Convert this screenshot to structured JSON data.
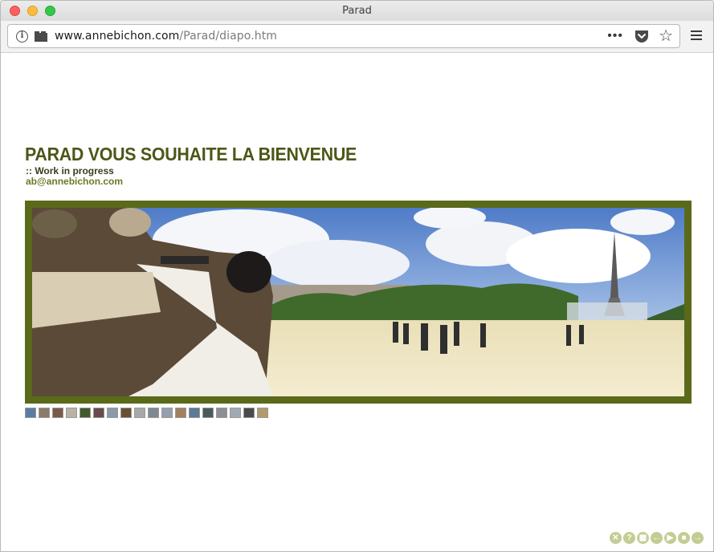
{
  "window": {
    "title": "Parad"
  },
  "browser": {
    "url_host": "www.annebichon.com",
    "url_path": "/Parad/diapo.htm",
    "more_glyph": "•••",
    "star_glyph": "☆",
    "info_glyph": "i"
  },
  "page": {
    "heading": "PARAD VOUS SOUHAITE LA BIENVENUE",
    "subline": ":: Work in progress",
    "email": "ab@annebichon.com"
  },
  "colors": {
    "heading": "#4c5718",
    "frame": "#5a6a1a",
    "email": "#6b7a25",
    "controls": "#c4cc94"
  },
  "thumbnails": [
    {
      "color": "#5a7da3"
    },
    {
      "color": "#8a7b6a"
    },
    {
      "color": "#7a5a4a"
    },
    {
      "color": "#b9b3a4"
    },
    {
      "color": "#3f5a2f"
    },
    {
      "color": "#6a4a4a"
    },
    {
      "color": "#8c9aa8"
    },
    {
      "color": "#6a5033"
    },
    {
      "color": "#a8a8a8"
    },
    {
      "color": "#7d8a91"
    },
    {
      "color": "#94a0ae"
    },
    {
      "color": "#a08060"
    },
    {
      "color": "#5a7a95"
    },
    {
      "color": "#4a5a5a"
    },
    {
      "color": "#8a9094"
    },
    {
      "color": "#a1aab4"
    },
    {
      "color": "#4a4a4a"
    },
    {
      "color": "#b29a6a"
    }
  ],
  "controls": [
    {
      "name": "close-control",
      "glyph": "✕"
    },
    {
      "name": "help-control",
      "glyph": "?"
    },
    {
      "name": "grid-control",
      "glyph": "▦"
    },
    {
      "name": "previous-control",
      "glyph": "←"
    },
    {
      "name": "play-control",
      "glyph": "▶"
    },
    {
      "name": "stop-control",
      "glyph": "■"
    },
    {
      "name": "next-control",
      "glyph": "→"
    }
  ]
}
